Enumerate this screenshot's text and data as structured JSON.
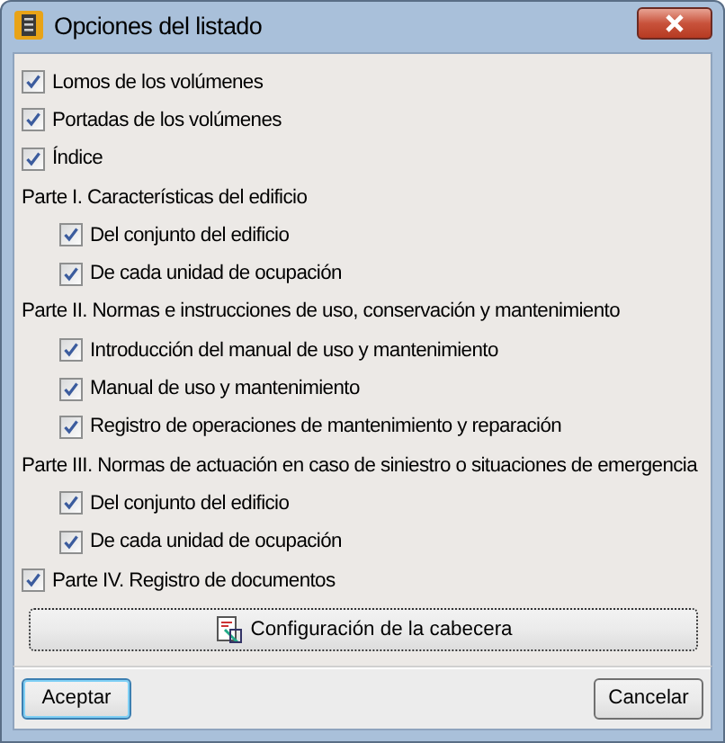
{
  "window": {
    "title": "Opciones del listado"
  },
  "options": [
    {
      "kind": "check",
      "label": "Lomos de los volúmenes",
      "checked": true
    },
    {
      "kind": "check",
      "label": "Portadas de los volúmenes",
      "checked": true
    },
    {
      "kind": "check",
      "label": "Índice",
      "checked": true
    },
    {
      "kind": "heading",
      "label": "Parte I. Características del edificio",
      "children": [
        {
          "kind": "check",
          "label": "Del conjunto del edificio",
          "checked": true
        },
        {
          "kind": "check",
          "label": "De cada unidad de ocupación",
          "checked": true
        }
      ]
    },
    {
      "kind": "heading",
      "label": "Parte II. Normas e instrucciones de uso, conservación y mantenimiento",
      "children": [
        {
          "kind": "check",
          "label": "Introducción del manual de uso y mantenimiento",
          "checked": true
        },
        {
          "kind": "check",
          "label": "Manual de uso y mantenimiento",
          "checked": true
        },
        {
          "kind": "check",
          "label": "Registro de operaciones de mantenimiento y reparación",
          "checked": true
        }
      ]
    },
    {
      "kind": "heading",
      "label": "Parte III. Normas de actuación en caso de siniestro o situaciones de emergencia",
      "children": [
        {
          "kind": "check",
          "label": "Del conjunto del edificio",
          "checked": true
        },
        {
          "kind": "check",
          "label": "De cada unidad de ocupación",
          "checked": true
        }
      ]
    },
    {
      "kind": "check",
      "label": "Parte IV. Registro de documentos",
      "checked": true
    }
  ],
  "header_button": "Configuración de la cabecera",
  "buttons": [
    {
      "label": "Aceptar",
      "kind": "default"
    },
    {
      "label": "Cancelar",
      "kind": "normal"
    }
  ]
}
